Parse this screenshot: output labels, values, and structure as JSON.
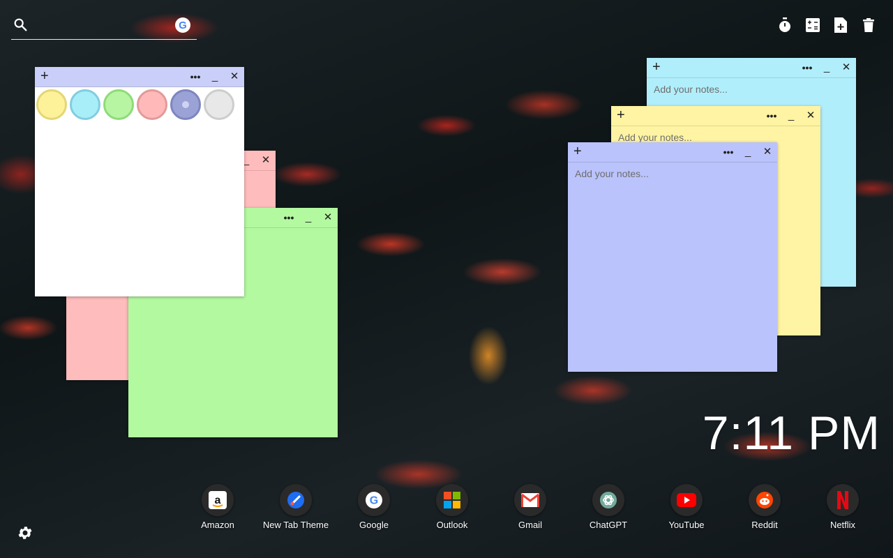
{
  "search": {
    "placeholder": "",
    "engine_icon": "google-g-icon",
    "engine_letter": "G"
  },
  "toolbar": {
    "items": [
      "timer-icon",
      "calculator-icon",
      "new-note-icon",
      "trash-icon"
    ]
  },
  "notes": {
    "placeholder": "Add your notes...",
    "palette": {
      "colors": [
        "#fdf29a",
        "#a8eef8",
        "#b7f5a2",
        "#ffb9b9",
        "#9aa2d6",
        "#e8e8e8"
      ]
    },
    "pink_color": "#ffbcbc",
    "green_color": "#b3f9a0",
    "cyan_color": "#b1eefb",
    "yellow_color": "#fff4a3",
    "blue_color": "#bac3fb"
  },
  "clock": {
    "time": "7:11 PM"
  },
  "shortcuts": [
    {
      "label": "Amazon",
      "icon": "amazon-icon"
    },
    {
      "label": "New Tab Theme",
      "icon": "new-tab-theme-icon"
    },
    {
      "label": "Google",
      "icon": "google-icon"
    },
    {
      "label": "Outlook",
      "icon": "outlook-icon"
    },
    {
      "label": "Gmail",
      "icon": "gmail-icon"
    },
    {
      "label": "ChatGPT",
      "icon": "chatgpt-icon"
    },
    {
      "label": "YouTube",
      "icon": "youtube-icon"
    },
    {
      "label": "Reddit",
      "icon": "reddit-icon"
    },
    {
      "label": "Netflix",
      "icon": "netflix-icon"
    }
  ],
  "settings": {
    "icon": "gear-icon"
  }
}
